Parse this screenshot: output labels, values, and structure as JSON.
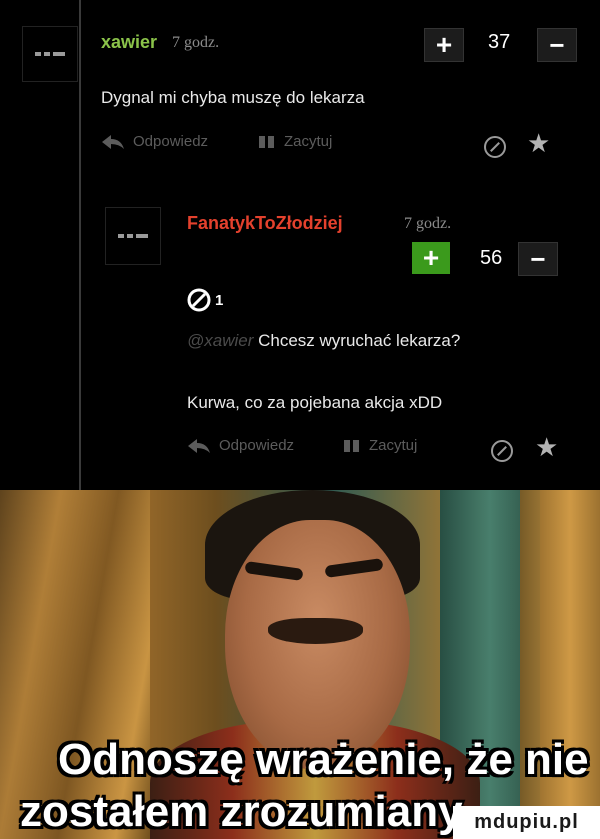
{
  "comments": [
    {
      "username": "xawier",
      "time": "7 godz.",
      "plus_label": "+",
      "votes": "37",
      "minus_label": "−",
      "text": "Dygnal mi chyba muszę do lekarza",
      "reply_label": "Odpowiedz",
      "quote_label": "Zacytuj",
      "username_color": "#8bc34a"
    },
    {
      "username": "FanatykToZłodziej",
      "time": "7 godz.",
      "plus_label": "+",
      "votes": "56",
      "minus_label": "−",
      "attachment_count": "1",
      "mention": "@xawier",
      "text": "Chcesz wyruchać lekarza?",
      "text2": "Kurwa, co za pojebana akcja xDD",
      "reply_label": "Odpowiedz",
      "quote_label": "Zacytuj",
      "username_color": "#e4412d"
    }
  ],
  "icons": [
    "reply-arrow-icon",
    "quote-icon",
    "report-icon",
    "star-icon",
    "attachment-icon"
  ],
  "meme": {
    "caption_line1": "Odnoszę wrażenie, że nie",
    "caption_line2": "zostałem zrozumiany"
  },
  "watermark": "mdupiu.pl"
}
